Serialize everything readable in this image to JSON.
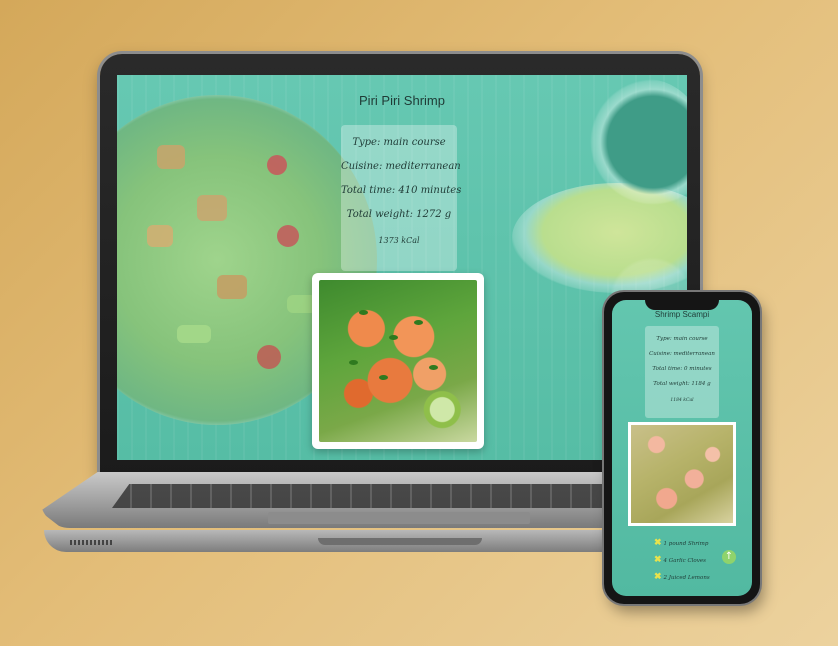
{
  "desktop": {
    "title": "Piri Piri Shrimp",
    "type_line": "Type: main course",
    "cuisine_line": "Cuisine: mediterranean",
    "time_line": "Total time: 410 minutes",
    "weight_line": "Total weight: 1272 g",
    "calories_line": "1373 kCal",
    "photo_alt": "Piri Piri Shrimp photo"
  },
  "mobile": {
    "title": "Shrimp Scampi",
    "type_line": "Type: main course",
    "cuisine_line": "Cuisine: mediterranean",
    "time_line": "Total time: 0 minutes",
    "weight_line": "Total weight: 1184 g",
    "calories_line": "1184 kCal",
    "ingredients": [
      "1 pound Shrimp",
      "4 Garlic Cloves",
      "2 Juiced Lemons"
    ],
    "check_glyph": "✖",
    "fab_icon": "arrow-up-icon",
    "fab_glyph": "↑"
  },
  "colors": {
    "page_bg": "#e3bd78",
    "teal": "#5fc3ad",
    "check": "#e9e24c",
    "fab": "#8fd36c"
  }
}
